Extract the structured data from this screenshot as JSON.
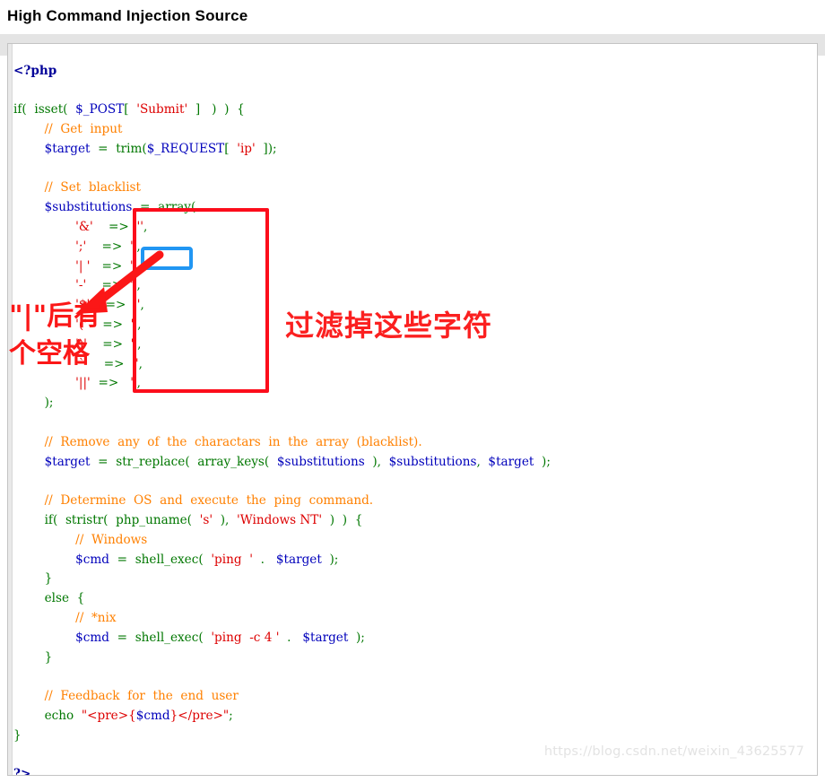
{
  "page": {
    "title": "High Command Injection Source",
    "watermark": "https://blog.csdn.net/weixin_43625577"
  },
  "colors": {
    "annotation_red": "#fc0d1b",
    "annotation_blue": "#2196f3",
    "note_red": "#fb1717",
    "panel_background": "#ffffff",
    "panel_border": "#c3c3c3",
    "outer_band": "#e4e4e4",
    "watermark": "#e3e3e3",
    "syntax_tag": "#000099",
    "syntax_keyword": "#007700",
    "syntax_variable": "#0000bb",
    "syntax_string": "#dd0000",
    "syntax_comment": "#ff8000"
  },
  "code": {
    "language": "php",
    "lines": [
      "<?php",
      "",
      "if( isset( $_POST[ 'Submit' ]  ) ) {",
      "        // Get input",
      "        $target = trim($_REQUEST[ 'ip' ]);",
      "",
      "        // Set blacklist",
      "        $substitutions = array(",
      "                '&'  => '',",
      "                ';'  => '',",
      "                '| ' => '',",
      "                '-'  => '',",
      "                '$'  => '',",
      "                '('  => '',",
      "                ')'  => '',",
      "                '`'  => '',",
      "                '||' => '',",
      "        );",
      "",
      "        // Remove any of the charactars in the array (blacklist).",
      "        $target = str_replace( array_keys( $substitutions ), $substitutions, $target );",
      "",
      "        // Determine OS and execute the ping command.",
      "        if( stristr( php_uname( 's' ), 'Windows NT' ) ) {",
      "                // Windows",
      "                $cmd = shell_exec( 'ping  ' . $target );",
      "        }",
      "        else {",
      "                // *nix",
      "                $cmd = shell_exec( 'ping  -c 4 ' . $target );",
      "        }",
      "",
      "        // Feedback for the end user",
      "        echo \"<pre>{$cmd}</pre>\";",
      "}",
      "",
      "?>"
    ],
    "blacklist_entries": [
      {
        "key": "&",
        "value": ""
      },
      {
        "key": ";",
        "value": ""
      },
      {
        "key": "| ",
        "value": ""
      },
      {
        "key": "-",
        "value": ""
      },
      {
        "key": "$",
        "value": ""
      },
      {
        "key": "(",
        "value": ""
      },
      {
        "key": ")",
        "value": ""
      },
      {
        "key": "`",
        "value": ""
      },
      {
        "key": "||",
        "value": ""
      }
    ]
  },
  "annotations": {
    "note_left_line1": "\"|\"后有",
    "note_left_line2": "个空格",
    "note_right": "过滤掉这些字符",
    "highlighted_entry": "| "
  }
}
